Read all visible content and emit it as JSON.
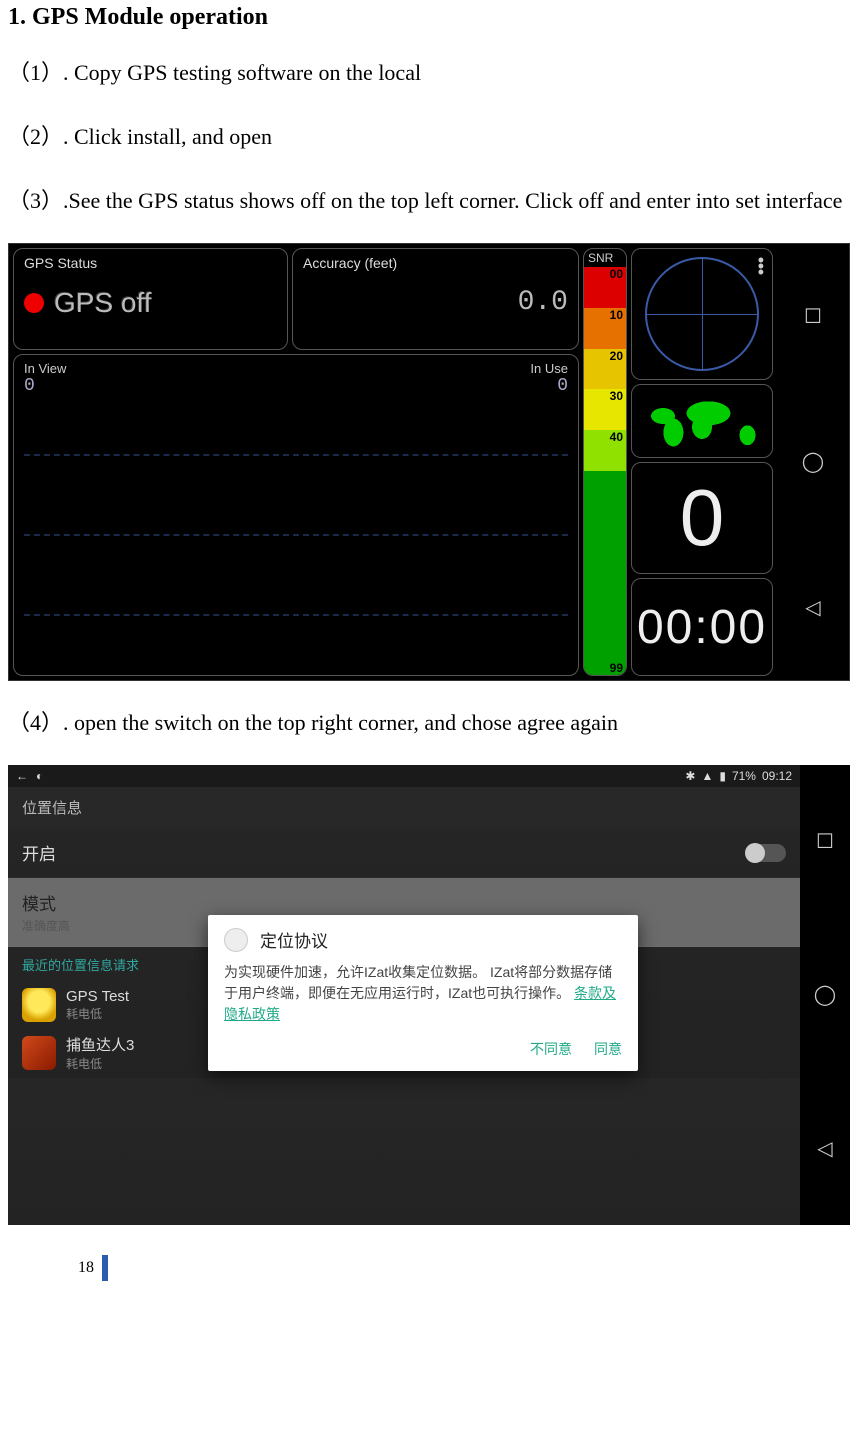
{
  "heading": "1. GPS Module operation",
  "step1": "（1）. Copy GPS testing software on the local",
  "step2": "（2）. Click install, and open",
  "step3": "（3）.See the GPS status shows off on the top left corner. Click off and enter into set interface",
  "step4": "（4）. open the switch on the top right corner, and chose agree again",
  "page_number": "18",
  "gps": {
    "status_label": "GPS Status",
    "status_text": "GPS off",
    "accuracy_label": "Accuracy (feet)",
    "accuracy_value": "0.0",
    "in_view_label": "In View",
    "in_view_value": "0",
    "in_use_label": "In Use",
    "in_use_value": "0",
    "snr_label": "SNR",
    "snr_ticks": {
      "t00": "00",
      "t10": "10",
      "t20": "20",
      "t30": "30",
      "t40": "40",
      "t99": "99"
    },
    "speed": "0",
    "time": "00:00"
  },
  "settings": {
    "status_time": "09:12",
    "battery": "71%",
    "header": "位置信息",
    "row_enable": "开启",
    "row_mode": "模式",
    "row_mode_sub": "准确度高",
    "section_recent": "最近的位置信息请求",
    "app1_name": "GPS Test",
    "app1_sub": "耗电低",
    "app2_name": "捕鱼达人3",
    "app2_sub": "耗电低",
    "dialog_title": "定位协议",
    "dialog_body_a": "为实现硬件加速，允许IZat收集定位数据。 IZat将部分数据存储于用户终端，即便在无应用运行时，IZat也可执行操作。",
    "dialog_link": "条款及隐私政策",
    "dialog_disagree": "不同意",
    "dialog_agree": "同意"
  }
}
